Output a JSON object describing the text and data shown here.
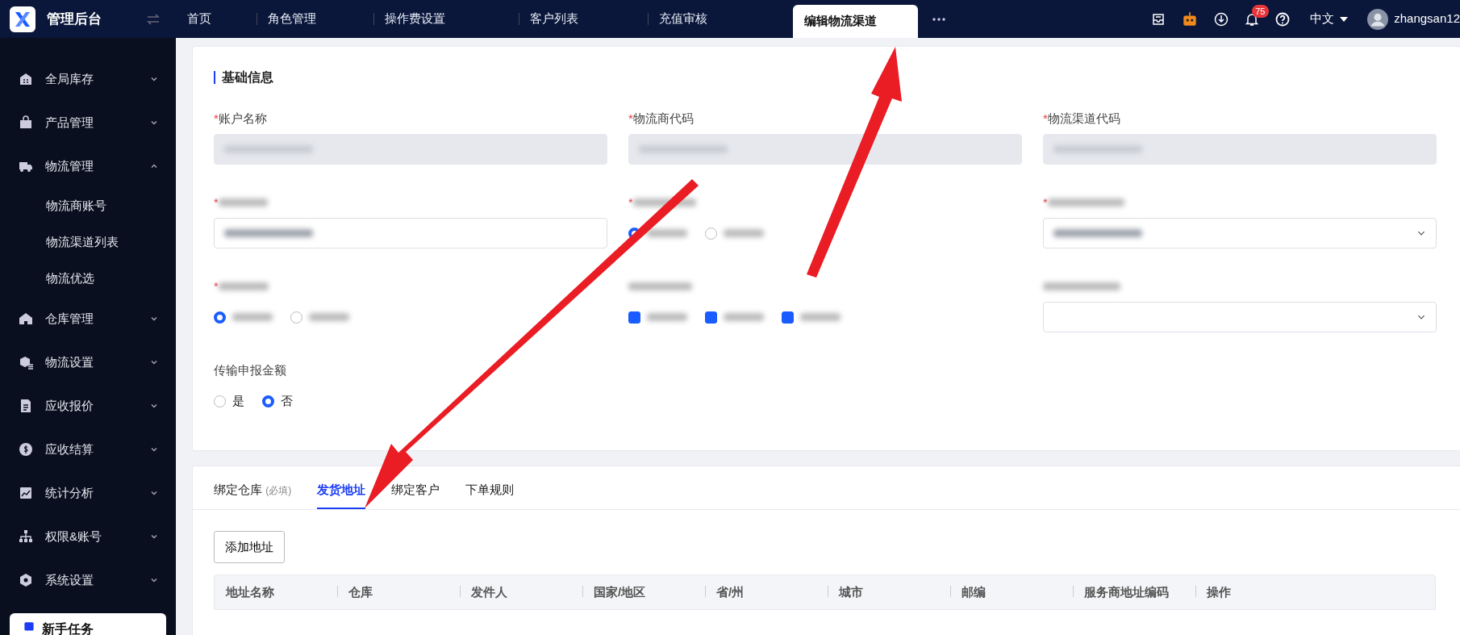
{
  "app": {
    "title": "管理后台"
  },
  "header_tabs": [
    {
      "label": "首页",
      "selected": false
    },
    {
      "label": "角色管理",
      "selected": false
    },
    {
      "label": "操作费设置",
      "selected": false
    },
    {
      "label": "客户列表",
      "selected": false
    },
    {
      "label": "充值审核",
      "selected": false
    },
    {
      "label": "编辑物流渠道",
      "selected": true
    }
  ],
  "header": {
    "notification_count": "75",
    "language": "中文",
    "username": "zhangsan12"
  },
  "sidebar": {
    "items": [
      {
        "label": "全局库存",
        "expanded": false
      },
      {
        "label": "产品管理",
        "expanded": false
      },
      {
        "label": "物流管理",
        "expanded": true,
        "children": [
          {
            "label": "物流商账号"
          },
          {
            "label": "物流渠道列表"
          },
          {
            "label": "物流优选"
          }
        ]
      },
      {
        "label": "仓库管理",
        "expanded": false
      },
      {
        "label": "物流设置",
        "expanded": false
      },
      {
        "label": "应收报价",
        "expanded": false
      },
      {
        "label": "应收结算",
        "expanded": false
      },
      {
        "label": "统计分析",
        "expanded": false
      },
      {
        "label": "权限&账号",
        "expanded": false
      },
      {
        "label": "系统设置",
        "expanded": false
      }
    ],
    "task_card": {
      "title": "新手任务"
    }
  },
  "basic_info": {
    "title": "基础信息",
    "fields": [
      {
        "kind": "text",
        "label": "账户名称",
        "required_mark": "*",
        "disabled": true,
        "value_redacted": true
      },
      {
        "kind": "text",
        "label": "物流商代码",
        "required_mark": "*",
        "disabled": true,
        "value_redacted": true
      },
      {
        "kind": "text",
        "label": "物流渠道代码",
        "required_mark": "*",
        "disabled": true,
        "value_redacted": true
      },
      {
        "kind": "text",
        "label_redacted": true,
        "required_mark": "*",
        "disabled": false,
        "value_redacted": true
      },
      {
        "kind": "radio",
        "label_redacted": true,
        "required_mark": "*",
        "options": [
          {
            "selected": true
          },
          {
            "selected": false
          }
        ]
      },
      {
        "kind": "select",
        "label_redacted": true,
        "required_mark": "*",
        "value_redacted": true
      },
      {
        "kind": "radio",
        "label_redacted": true,
        "required_mark": "*",
        "options": [
          {
            "selected": true
          },
          {
            "selected": false
          }
        ]
      },
      {
        "kind": "checkbox",
        "label_redacted": true,
        "options": [
          {
            "checked": true
          },
          {
            "checked": true
          },
          {
            "checked": true
          }
        ]
      },
      {
        "kind": "select",
        "label_redacted": true,
        "value_redacted": false
      },
      {
        "kind": "radio",
        "label": "传输申报金额",
        "options": [
          {
            "label": "是",
            "selected": false
          },
          {
            "label": "否",
            "selected": true
          }
        ]
      }
    ]
  },
  "detail_tabs": [
    {
      "label": "绑定仓库",
      "note": "(必填)",
      "selected": false
    },
    {
      "label": "发货地址",
      "selected": true
    },
    {
      "label": "绑定客户",
      "selected": false
    },
    {
      "label": "下单规则",
      "selected": false
    }
  ],
  "add_button": "添加地址",
  "table": {
    "columns": [
      "地址名称",
      "仓库",
      "发件人",
      "国家/地区",
      "省/州",
      "城市",
      "邮编",
      "服务商地址编码",
      "操作"
    ]
  }
}
